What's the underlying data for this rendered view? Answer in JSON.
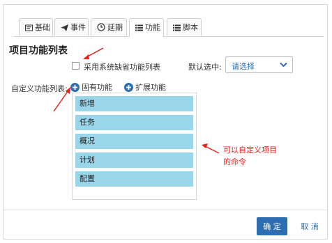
{
  "tabs": [
    {
      "label": "基础",
      "icon": "card-icon",
      "active": false
    },
    {
      "label": "事件",
      "icon": "send-icon",
      "active": false
    },
    {
      "label": "延期",
      "icon": "clock-plus-icon",
      "active": false
    },
    {
      "label": "功能",
      "icon": "list-icon",
      "active": true
    },
    {
      "label": "脚本",
      "icon": "list-icon",
      "active": false
    }
  ],
  "title": "项目功能列表",
  "use_default": {
    "label": "采用系统缺省功能列表",
    "checked": false
  },
  "default_select": {
    "label": "默认选中:",
    "value": "请选择"
  },
  "custom_list": {
    "label": "自定义功能列表:",
    "builtin_link": "固有功能",
    "extend_link": "扩展功能",
    "items": [
      "新增",
      "任务",
      "概况",
      "计划",
      "配置"
    ]
  },
  "annotation": {
    "line1": "可以自定义项目",
    "line2": "的命令"
  },
  "footer": {
    "ok": "确 定",
    "cancel": "取 消"
  },
  "colors": {
    "accent": "#2d6db1",
    "item_bg": "#9ad6e9",
    "annotation": "#e8231c"
  }
}
